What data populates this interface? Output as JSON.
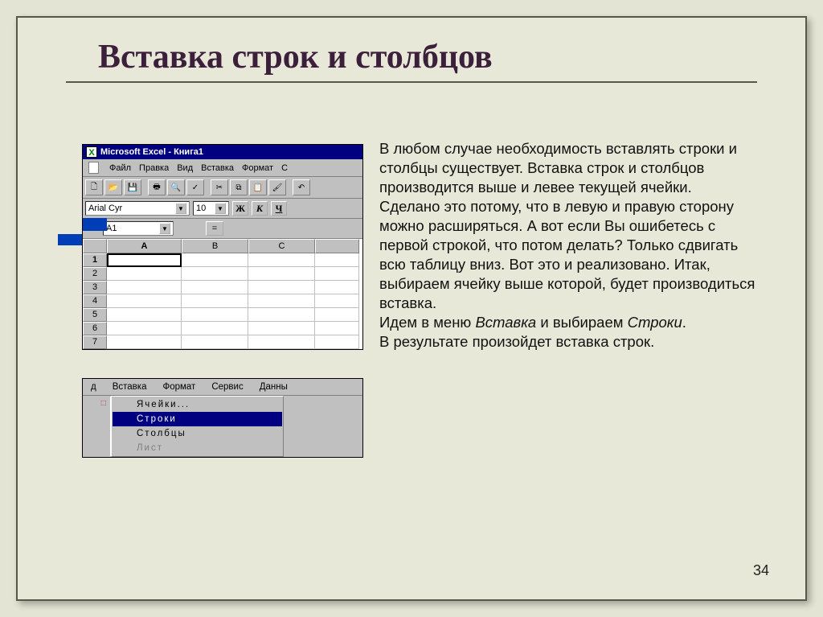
{
  "title": "Вставка строк и столбцов",
  "body": {
    "p1": "В любом случае необходимость вставлять строки и столбцы существует. Вставка строк и столбцов производится выше и левее текущей ячейки.",
    "p2": "Сделано это потому, что в левую и правую сторону можно расширяться. А вот если Вы ошибетесь с первой строкой, что потом делать? Только сдвигать всю таблицу вниз. Вот это и реализовано. Итак, выбираем ячейку выше которой, будет производиться вставка.",
    "p3a": "Идем в меню ",
    "p3b": "Вставка",
    "p3c": " и выбираем ",
    "p3d": "Строки",
    "p3e": ".",
    "p4": "В результате произойдет вставка строк."
  },
  "page_num": "34",
  "excel": {
    "title": "Microsoft Excel - Книга1",
    "menu": [
      "Файл",
      "Правка",
      "Вид",
      "Вставка",
      "Формат",
      "С"
    ],
    "font_name": "Arial Cyr",
    "font_size": "10",
    "bold": "Ж",
    "italic": "К",
    "under": "Ч",
    "namebox": "A1",
    "eq": "=",
    "cols": [
      "A",
      "B",
      "C"
    ],
    "rows": [
      "1",
      "2",
      "3",
      "4",
      "5",
      "6",
      "7"
    ]
  },
  "menu2": {
    "bar": [
      "д",
      "Вставка",
      "Формат",
      "Сервис",
      "Данны"
    ],
    "items": {
      "cells": "Ячейки...",
      "rows": "Строки",
      "columns": "Столбцы",
      "sheet": "Лист"
    }
  }
}
